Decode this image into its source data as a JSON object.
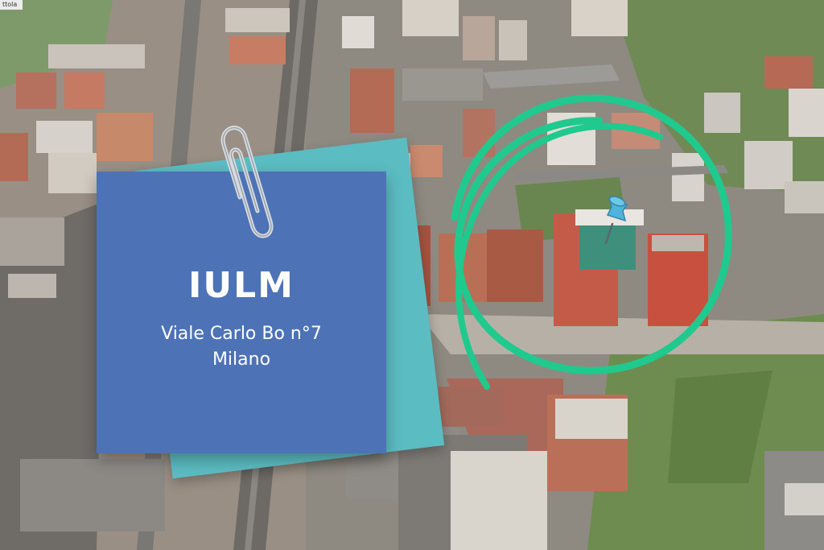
{
  "note": {
    "title": "IULM",
    "address_line": "Viale Carlo Bo n°7",
    "city": "Milano"
  },
  "corner_tag": "ttola",
  "icons": {
    "clip": "paperclip-icon",
    "pin": "push-pin-icon"
  },
  "colors": {
    "note_front": "#4d73b6",
    "note_back": "#5bbcc2",
    "circle_marker": "#20c98d",
    "pin": "#4fb3dc"
  }
}
